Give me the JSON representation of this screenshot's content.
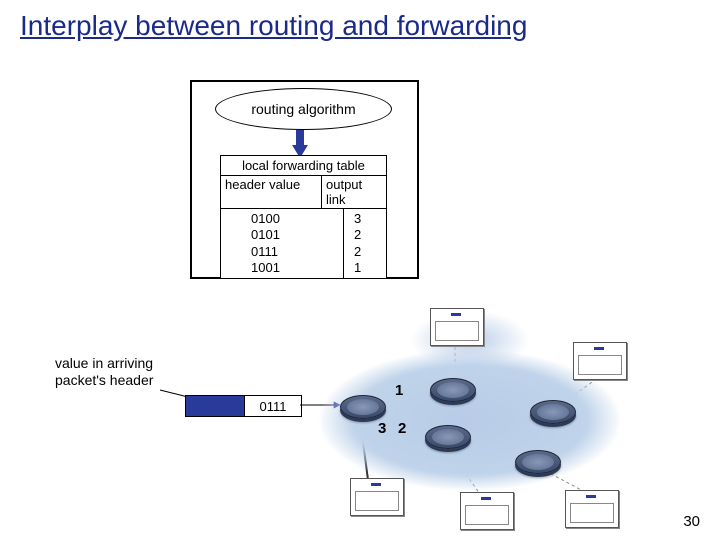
{
  "title": "Interplay between routing and forwarding",
  "algorithm_label": "routing algorithm",
  "forwarding_table": {
    "title": "local forwarding table",
    "col_header": "header value",
    "col_output": "output link",
    "rows": [
      {
        "h": "0100",
        "o": "3"
      },
      {
        "h": "0101",
        "o": "2"
      },
      {
        "h": "0111",
        "o": "2"
      },
      {
        "h": "1001",
        "o": "1"
      }
    ]
  },
  "arriving_label_l1": "value in arriving",
  "arriving_label_l2": "packet's header",
  "packet_header_value": "0111",
  "ports": {
    "p1": "1",
    "p2": "2",
    "p3": "3"
  },
  "slide_number": "30"
}
